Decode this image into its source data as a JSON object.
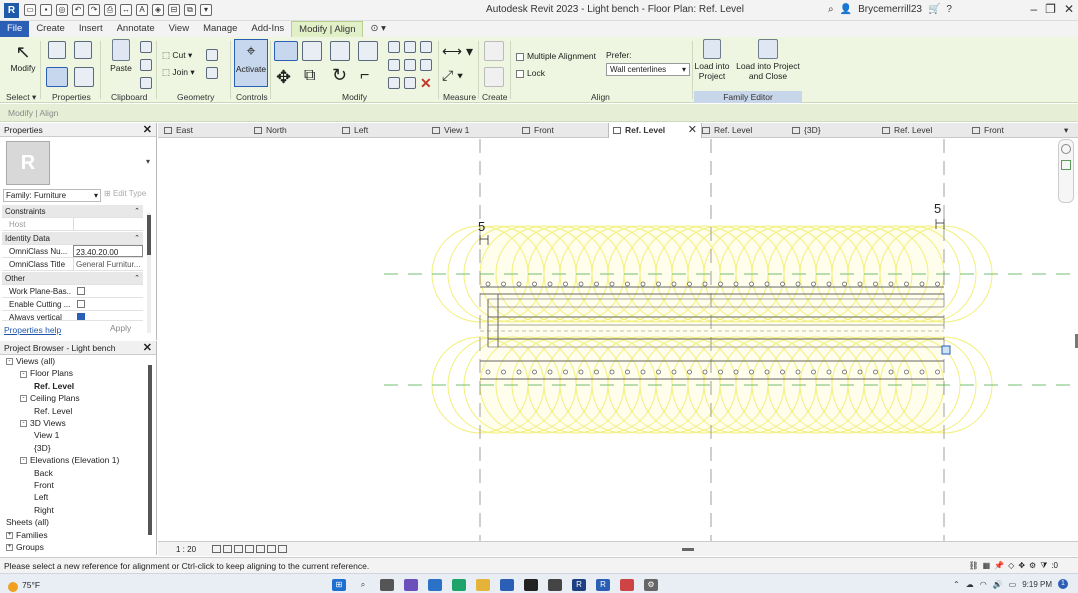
{
  "titlebar": {
    "app_title": "Autodesk Revit 2023 - Light bench - Floor Plan: Ref. Level",
    "user": "Brycemerrill23",
    "help": "?"
  },
  "ribbon_tabs": [
    "File",
    "Create",
    "Insert",
    "Annotate",
    "View",
    "Manage",
    "Add-Ins",
    "Modify | Align"
  ],
  "active_tab": "Modify | Align",
  "ribbon": {
    "modify_label": "Modify",
    "paste_label": "Paste",
    "cut_label": "Cut",
    "join_label": "Join",
    "activate_label": "Activate",
    "multiple_alignment": "Multiple Alignment",
    "lock": "Lock",
    "prefer_label": "Prefer:",
    "prefer_value": "Wall centerlines",
    "load_into_project": "Load into Project",
    "load_into_project_close": "Load into Project and Close",
    "groups": [
      "Select ▾",
      "Properties",
      "Clipboard",
      "Geometry",
      "Controls",
      "Modify",
      "Measure",
      "Create",
      "Align"
    ],
    "family_editor": "Family Editor"
  },
  "options_bar": {
    "text": "Modify | Align"
  },
  "properties": {
    "title": "Properties",
    "thumb_letter": "R",
    "family_selector": "Family: Furniture",
    "edit_type": "Edit Type",
    "rows": [
      {
        "type": "cat",
        "label": "Constraints"
      },
      {
        "type": "text",
        "key": "Host",
        "value": ""
      },
      {
        "type": "cat",
        "label": "Identity Data"
      },
      {
        "type": "box",
        "key": "OmniClass Nu...",
        "value": "23.40.20.00"
      },
      {
        "type": "text",
        "key": "OmniClass Title",
        "value": "General Furnitur..."
      },
      {
        "type": "cat",
        "label": "Other"
      },
      {
        "type": "check",
        "key": "Work Plane-Bas...",
        "checked": false
      },
      {
        "type": "check",
        "key": "Enable Cutting ...",
        "checked": false
      },
      {
        "type": "check",
        "key": "Always vertical",
        "checked": true
      }
    ],
    "help_link": "Properties help",
    "apply": "Apply"
  },
  "project_browser": {
    "title": "Project Browser - Light bench",
    "nodes": [
      {
        "label": "Views (all)",
        "level": 0,
        "toggle": "-"
      },
      {
        "label": "Floor Plans",
        "level": 1,
        "toggle": "-"
      },
      {
        "label": "Ref. Level",
        "level": 2,
        "toggle": "",
        "selected": true
      },
      {
        "label": "Ceiling Plans",
        "level": 1,
        "toggle": "-"
      },
      {
        "label": "Ref. Level",
        "level": 2,
        "toggle": ""
      },
      {
        "label": "3D Views",
        "level": 1,
        "toggle": "-"
      },
      {
        "label": "View 1",
        "level": 2,
        "toggle": ""
      },
      {
        "label": "{3D}",
        "level": 2,
        "toggle": ""
      },
      {
        "label": "Elevations (Elevation 1)",
        "level": 1,
        "toggle": "-"
      },
      {
        "label": "Back",
        "level": 2,
        "toggle": ""
      },
      {
        "label": "Front",
        "level": 2,
        "toggle": ""
      },
      {
        "label": "Left",
        "level": 2,
        "toggle": ""
      },
      {
        "label": "Right",
        "level": 2,
        "toggle": ""
      },
      {
        "label": "Sheets (all)",
        "level": 0,
        "toggle": ""
      },
      {
        "label": "Families",
        "level": 0,
        "toggle": "+"
      },
      {
        "label": "Groups",
        "level": 0,
        "toggle": "+"
      }
    ]
  },
  "view_tabs": [
    {
      "label": "East",
      "active": false
    },
    {
      "label": "North",
      "active": false
    },
    {
      "label": "Left",
      "active": false
    },
    {
      "label": "View 1",
      "active": false
    },
    {
      "label": "Front",
      "active": false
    },
    {
      "label": "Ref. Level",
      "active": true
    },
    {
      "label": "Ref. Level",
      "active": false
    },
    {
      "label": "{3D}",
      "active": false
    },
    {
      "label": "Ref. Level",
      "active": false
    },
    {
      "label": "Front",
      "active": false
    }
  ],
  "canvas": {
    "dim_left": "5",
    "dim_right": "5"
  },
  "view_control": {
    "scale": "1 : 20"
  },
  "status": {
    "message": "Please select a new reference for alignment or Ctrl-click to keep aligning to the current reference.",
    "filter_count": ":0"
  },
  "taskbar": {
    "weather": "75°F",
    "time": "9:19 PM",
    "notifications": "1"
  },
  "colors": {
    "accent": "#2b5fb6",
    "ribbon_bg": "#eef5e0",
    "highlight_yellow": "#f2ef7a"
  }
}
